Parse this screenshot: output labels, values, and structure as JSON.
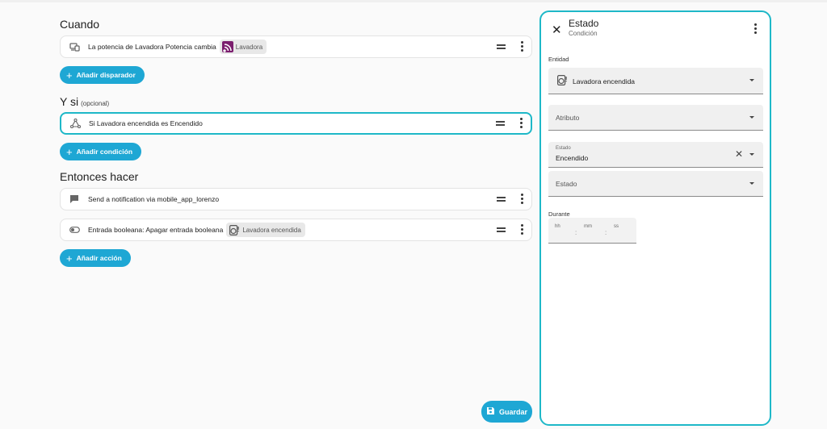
{
  "colors": {
    "accent": "#1ea7d4",
    "active_border": "#1eb8c8",
    "chip_bg": "#e8e8e8",
    "brand_purple": "#7b1e6e"
  },
  "triggers": {
    "title": "Cuando",
    "items": [
      {
        "text": "La potencia de Lavadora Potencia cambia",
        "chip": "Lavadora",
        "icon": "power-meter-icon",
        "chip_icon": "wifi-signal-icon"
      }
    ],
    "add_label": "Añadir disparador"
  },
  "conditions": {
    "title": "Y si",
    "optional": "(opcional)",
    "items": [
      {
        "text": "Si Lavadora encendida es Encendido",
        "icon": "state-graph-icon"
      }
    ],
    "add_label": "Añadir condición"
  },
  "actions": {
    "title": "Entonces hacer",
    "items": [
      {
        "text": "Send a notification via mobile_app_lorenzo",
        "icon": "message-icon"
      },
      {
        "text": "Entrada booleana: Apagar entrada booleana",
        "chip": "Lavadora encendida",
        "icon": "toggle-icon",
        "chip_icon": "washing-machine-icon"
      }
    ],
    "add_label": "Añadir acción"
  },
  "save_label": "Guardar",
  "panel": {
    "title": "Estado",
    "subtitle": "Condición",
    "entity_label": "Entidad",
    "entity_value": "Lavadora encendida",
    "attribute_placeholder": "Atributo",
    "state_small_label": "Estado",
    "state_value": "Encendido",
    "state2_placeholder": "Estado",
    "duration_label": "Durante",
    "duration": {
      "hh": "hh",
      "mm": "mm",
      "ss": "ss",
      "sep": ":"
    }
  }
}
